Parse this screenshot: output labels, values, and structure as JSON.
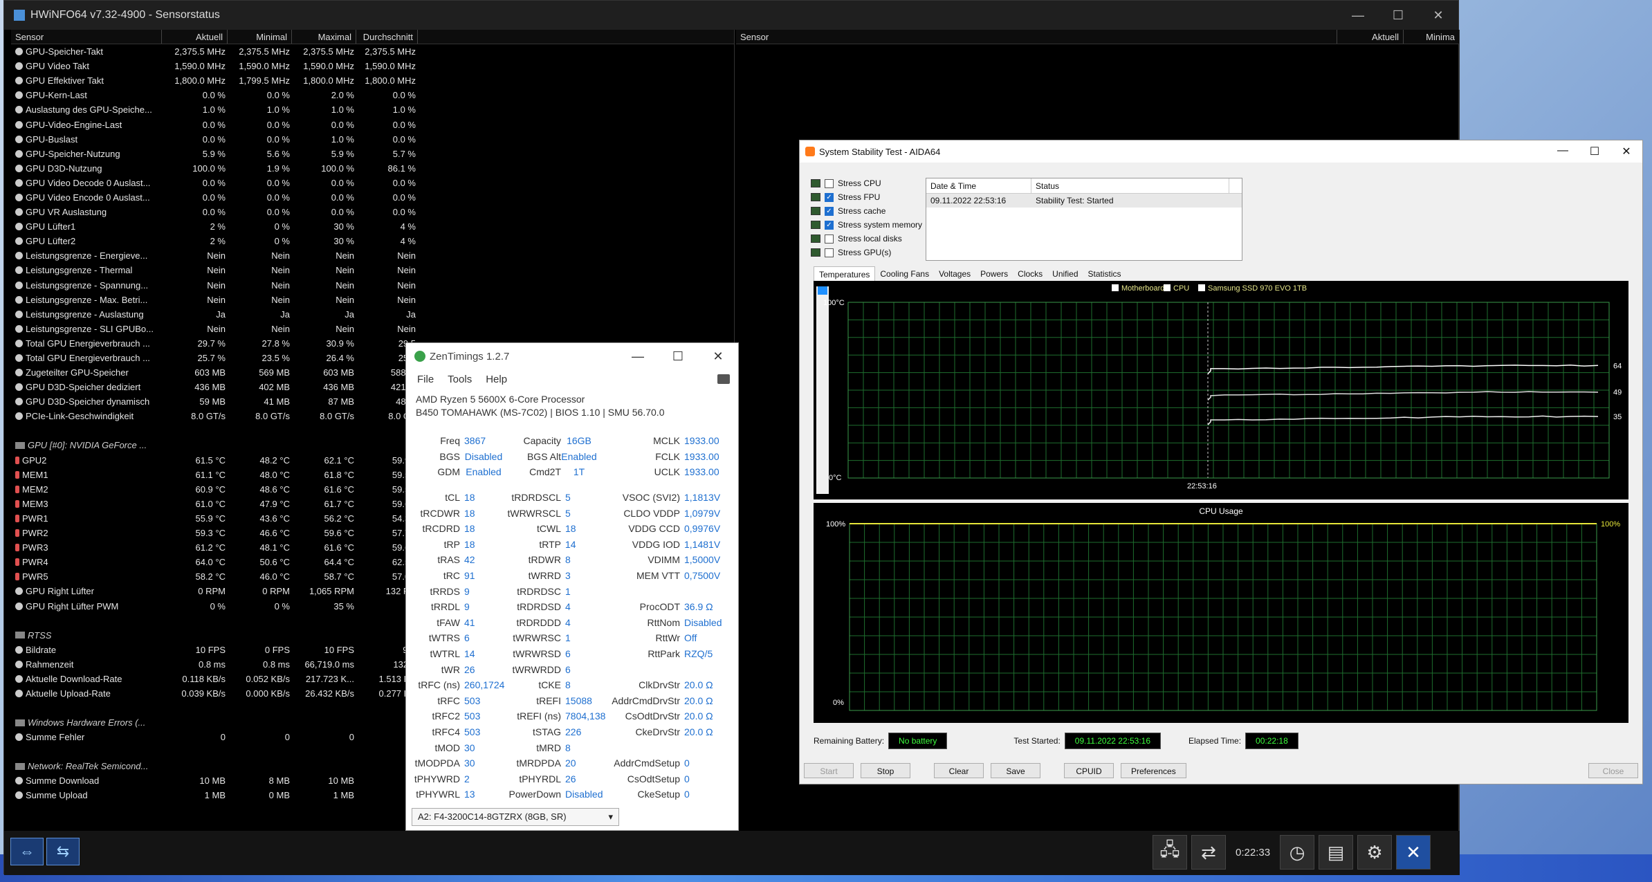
{
  "hwinfo": {
    "title": "HWiNFO64 v7.32-4900 - Sensorstatus",
    "columns": [
      "Sensor",
      "Aktuell",
      "Minimal",
      "Maximal",
      "Durchschnitt"
    ],
    "right_columns": [
      "Sensor",
      "Aktuell",
      "Minima"
    ],
    "rows": [
      {
        "n": "GPU-Speicher-Takt",
        "a": "2,375.5 MHz",
        "mi": "2,375.5 MHz",
        "ma": "2,375.5 MHz",
        "d": "2,375.5 MHz"
      },
      {
        "n": "GPU Video Takt",
        "a": "1,590.0 MHz",
        "mi": "1,590.0 MHz",
        "ma": "1,590.0 MHz",
        "d": "1,590.0 MHz"
      },
      {
        "n": "GPU Effektiver Takt",
        "a": "1,800.0 MHz",
        "mi": "1,799.5 MHz",
        "ma": "1,800.0 MHz",
        "d": "1,800.0 MHz"
      },
      {
        "n": "GPU-Kern-Last",
        "a": "0.0 %",
        "mi": "0.0 %",
        "ma": "2.0 %",
        "d": "0.0 %"
      },
      {
        "n": "Auslastung des GPU-Speiche...",
        "a": "1.0 %",
        "mi": "1.0 %",
        "ma": "1.0 %",
        "d": "1.0 %"
      },
      {
        "n": "GPU-Video-Engine-Last",
        "a": "0.0 %",
        "mi": "0.0 %",
        "ma": "0.0 %",
        "d": "0.0 %"
      },
      {
        "n": "GPU-Buslast",
        "a": "0.0 %",
        "mi": "0.0 %",
        "ma": "1.0 %",
        "d": "0.0 %"
      },
      {
        "n": "GPU-Speicher-Nutzung",
        "a": "5.9 %",
        "mi": "5.6 %",
        "ma": "5.9 %",
        "d": "5.7 %"
      },
      {
        "n": "GPU D3D-Nutzung",
        "a": "100.0 %",
        "mi": "1.9 %",
        "ma": "100.0 %",
        "d": "86.1 %"
      },
      {
        "n": "GPU Video Decode 0 Auslast...",
        "a": "0.0 %",
        "mi": "0.0 %",
        "ma": "0.0 %",
        "d": "0.0 %"
      },
      {
        "n": "GPU Video Encode 0 Auslast...",
        "a": "0.0 %",
        "mi": "0.0 %",
        "ma": "0.0 %",
        "d": "0.0 %"
      },
      {
        "n": "GPU VR Auslastung",
        "a": "0.0 %",
        "mi": "0.0 %",
        "ma": "0.0 %",
        "d": "0.0 %"
      },
      {
        "n": "GPU Lüfter1",
        "a": "2 %",
        "mi": "0 %",
        "ma": "30 %",
        "d": "4 %"
      },
      {
        "n": "GPU Lüfter2",
        "a": "2 %",
        "mi": "0 %",
        "ma": "30 %",
        "d": "4 %"
      },
      {
        "n": "Leistungsgrenze - Energieve...",
        "a": "Nein",
        "mi": "Nein",
        "ma": "Nein",
        "d": "Nein"
      },
      {
        "n": "Leistungsgrenze - Thermal",
        "a": "Nein",
        "mi": "Nein",
        "ma": "Nein",
        "d": "Nein"
      },
      {
        "n": "Leistungsgrenze - Spannung...",
        "a": "Nein",
        "mi": "Nein",
        "ma": "Nein",
        "d": "Nein"
      },
      {
        "n": "Leistungsgrenze - Max. Betri...",
        "a": "Nein",
        "mi": "Nein",
        "ma": "Nein",
        "d": "Nein"
      },
      {
        "n": "Leistungsgrenze - Auslastung",
        "a": "Ja",
        "mi": "Ja",
        "ma": "Ja",
        "d": "Ja"
      },
      {
        "n": "Leistungsgrenze - SLI GPUBo...",
        "a": "Nein",
        "mi": "Nein",
        "ma": "Nein",
        "d": "Nein"
      },
      {
        "n": "Total GPU Energieverbrauch ...",
        "a": "29.7 %",
        "mi": "27.8 %",
        "ma": "30.9 %",
        "d": "29.5"
      },
      {
        "n": "Total GPU Energieverbrauch ...",
        "a": "25.7 %",
        "mi": "23.5 %",
        "ma": "26.4 %",
        "d": "25.2"
      },
      {
        "n": "Zugeteilter GPU-Speicher",
        "a": "603 MB",
        "mi": "569 MB",
        "ma": "603 MB",
        "d": "588 M"
      },
      {
        "n": "GPU D3D-Speicher dediziert",
        "a": "436 MB",
        "mi": "402 MB",
        "ma": "436 MB",
        "d": "421 M"
      },
      {
        "n": "GPU D3D-Speicher dynamisch",
        "a": "59 MB",
        "mi": "41 MB",
        "ma": "87 MB",
        "d": "48 M"
      },
      {
        "n": "PCIe-Link-Geschwindigkeit",
        "a": "8.0 GT/s",
        "mi": "8.0 GT/s",
        "ma": "8.0 GT/s",
        "d": "8.0 GT"
      },
      {
        "blank": true
      },
      {
        "grp": true,
        "n": "GPU [#0]: NVIDIA GeForce ..."
      },
      {
        "t": true,
        "n": "GPU2",
        "a": "61.5 °C",
        "mi": "48.2 °C",
        "ma": "62.1 °C",
        "d": "59.9 °"
      },
      {
        "t": true,
        "n": "MEM1",
        "a": "61.1 °C",
        "mi": "48.0 °C",
        "ma": "61.8 °C",
        "d": "59.5 °"
      },
      {
        "t": true,
        "n": "MEM2",
        "a": "60.9 °C",
        "mi": "48.6 °C",
        "ma": "61.6 °C",
        "d": "59.5 °"
      },
      {
        "t": true,
        "n": "MEM3",
        "a": "61.0 °C",
        "mi": "47.9 °C",
        "ma": "61.7 °C",
        "d": "59.6 °"
      },
      {
        "t": true,
        "n": "PWR1",
        "a": "55.9 °C",
        "mi": "43.6 °C",
        "ma": "56.2 °C",
        "d": "54.3 °"
      },
      {
        "t": true,
        "n": "PWR2",
        "a": "59.3 °C",
        "mi": "46.6 °C",
        "ma": "59.6 °C",
        "d": "57.7 °"
      },
      {
        "t": true,
        "n": "PWR3",
        "a": "61.2 °C",
        "mi": "48.1 °C",
        "ma": "61.6 °C",
        "d": "59.6 °"
      },
      {
        "t": true,
        "n": "PWR4",
        "a": "64.0 °C",
        "mi": "50.6 °C",
        "ma": "64.4 °C",
        "d": "62.5 °"
      },
      {
        "t": true,
        "n": "PWR5",
        "a": "58.2 °C",
        "mi": "46.0 °C",
        "ma": "58.7 °C",
        "d": "57.0 °"
      },
      {
        "n": "GPU Right Lüfter",
        "a": "0 RPM",
        "mi": "0 RPM",
        "ma": "1,065 RPM",
        "d": "132 RP"
      },
      {
        "n": "GPU Right Lüfter PWM",
        "a": "0 %",
        "mi": "0 %",
        "ma": "35 %",
        "d": "4"
      },
      {
        "blank": true
      },
      {
        "grp": true,
        "n": "RTSS"
      },
      {
        "n": "Bildrate",
        "a": "10 FPS",
        "mi": "0 FPS",
        "ma": "10 FPS",
        "d": "9 F"
      },
      {
        "n": "Rahmenzeit",
        "a": "0.8 ms",
        "mi": "0.8 ms",
        "ma": "66,719.0 ms",
        "d": "132.5"
      },
      {
        "n": "Aktuelle Download-Rate",
        "a": "0.118 KB/s",
        "mi": "0.052 KB/s",
        "ma": "217.723 K...",
        "d": "1.513 KB"
      },
      {
        "n": "Aktuelle Upload-Rate",
        "a": "0.039 KB/s",
        "mi": "0.000 KB/s",
        "ma": "26.432 KB/s",
        "d": "0.277 KB"
      },
      {
        "blank": true
      },
      {
        "grp": true,
        "n": "Windows Hardware Errors (..."
      },
      {
        "n": "Summe Fehler",
        "a": "0",
        "mi": "0",
        "ma": "0",
        "d": ""
      },
      {
        "blank": true
      },
      {
        "grp": true,
        "n": "Network: RealTek Semicond..."
      },
      {
        "n": "Summe Download",
        "a": "10 MB",
        "mi": "8 MB",
        "ma": "10 MB",
        "d": ""
      },
      {
        "n": "Summe Upload",
        "a": "1 MB",
        "mi": "0 MB",
        "ma": "1 MB",
        "d": ""
      }
    ],
    "clock": "0:22:33"
  },
  "zen": {
    "title": "ZenTimings 1.2.7",
    "menu": [
      "File",
      "Tools",
      "Help"
    ],
    "cpu": "AMD Ryzen 5 5600X 6-Core Processor",
    "board": "B450 TOMAHAWK (MS-7C02) | BIOS 1.10 | SMU 56.70.0",
    "rows": [
      [
        "Freq",
        "3867",
        "Capacity",
        "16GB",
        "MCLK",
        "1933.00"
      ],
      [
        "BGS",
        "Disabled",
        "BGS Alt",
        "Enabled",
        "FCLK",
        "1933.00"
      ],
      [
        "GDM",
        "Enabled",
        "Cmd2T",
        "1T",
        "UCLK",
        "1933.00"
      ],
      null,
      [
        "tCL",
        "18",
        "tRDRDSCL",
        "5",
        "VSOC (SVI2)",
        "1,1813V"
      ],
      [
        "tRCDWR",
        "18",
        "tWRWRSCL",
        "5",
        "CLDO VDDP",
        "1,0979V"
      ],
      [
        "tRCDRD",
        "18",
        "tCWL",
        "18",
        "VDDG CCD",
        "0,9976V"
      ],
      [
        "tRP",
        "18",
        "tRTP",
        "14",
        "VDDG IOD",
        "1,1481V"
      ],
      [
        "tRAS",
        "42",
        "tRDWR",
        "8",
        "VDIMM",
        "1,5000V"
      ],
      [
        "tRC",
        "91",
        "tWRRD",
        "3",
        "MEM VTT",
        "0,7500V"
      ],
      [
        "tRRDS",
        "9",
        "tRDRDSC",
        "1",
        "",
        ""
      ],
      [
        "tRRDL",
        "9",
        "tRDRDSD",
        "4",
        "ProcODT",
        "36.9 Ω"
      ],
      [
        "tFAW",
        "41",
        "tRDRDDD",
        "4",
        "RttNom",
        "Disabled"
      ],
      [
        "tWTRS",
        "6",
        "tWRWRSC",
        "1",
        "RttWr",
        "Off"
      ],
      [
        "tWTRL",
        "14",
        "tWRWRSD",
        "6",
        "RttPark",
        "RZQ/5"
      ],
      [
        "tWR",
        "26",
        "tWRWRDD",
        "6",
        "",
        ""
      ],
      [
        "tRFC (ns)",
        "260,1724",
        "tCKE",
        "8",
        "ClkDrvStr",
        "20.0 Ω"
      ],
      [
        "tRFC",
        "503",
        "tREFI",
        "15088",
        "AddrCmdDrvStr",
        "20.0 Ω"
      ],
      [
        "tRFC2",
        "503",
        "tREFI (ns)",
        "7804,138",
        "CsOdtDrvStr",
        "20.0 Ω"
      ],
      [
        "tRFC4",
        "503",
        "tSTAG",
        "226",
        "CkeDrvStr",
        "20.0 Ω"
      ],
      [
        "tMOD",
        "30",
        "tMRD",
        "8",
        "",
        ""
      ],
      [
        "tMODPDA",
        "30",
        "tMRDPDA",
        "20",
        "AddrCmdSetup",
        "0"
      ],
      [
        "tPHYWRD",
        "2",
        "tPHYRDL",
        "26",
        "CsOdtSetup",
        "0"
      ],
      [
        "tPHYWRL",
        "13",
        "PowerDown",
        "Disabled",
        "CkeSetup",
        "0"
      ]
    ],
    "module": "A2: F4-3200C14-8GTZRX (8GB, SR)"
  },
  "aida": {
    "title": "System Stability Test - AIDA64",
    "stress": [
      {
        "label": "Stress CPU",
        "on": false
      },
      {
        "label": "Stress FPU",
        "on": true
      },
      {
        "label": "Stress cache",
        "on": true
      },
      {
        "label": "Stress system memory",
        "on": true
      },
      {
        "label": "Stress local disks",
        "on": false
      },
      {
        "label": "Stress GPU(s)",
        "on": false
      }
    ],
    "log_head": [
      "Date & Time",
      "Status"
    ],
    "log_row": [
      "09.11.2022 22:53:16",
      "Stability Test: Started"
    ],
    "tabs": [
      "Temperatures",
      "Cooling Fans",
      "Voltages",
      "Powers",
      "Clocks",
      "Unified",
      "Statistics"
    ],
    "legend": [
      "Motherboard",
      "CPU",
      "Samsung SSD 970 EVO 1TB"
    ],
    "temp_chart": {
      "ymax": "100°C",
      "ymin": "0°C",
      "xlabel": "22:53:16",
      "values": [
        "64",
        "49",
        "35"
      ]
    },
    "cpu_chart": {
      "title": "CPU Usage",
      "ymax": "100%",
      "ymin": "0%",
      "value": "100%"
    },
    "info": {
      "battery_label": "Remaining Battery:",
      "battery": "No battery",
      "started_label": "Test Started:",
      "started": "09.11.2022 22:53:16",
      "elapsed_label": "Elapsed Time:",
      "elapsed": "00:22:18"
    },
    "buttons": [
      "Start",
      "Stop",
      "Clear",
      "Save",
      "CPUID",
      "Preferences",
      "Close"
    ]
  }
}
